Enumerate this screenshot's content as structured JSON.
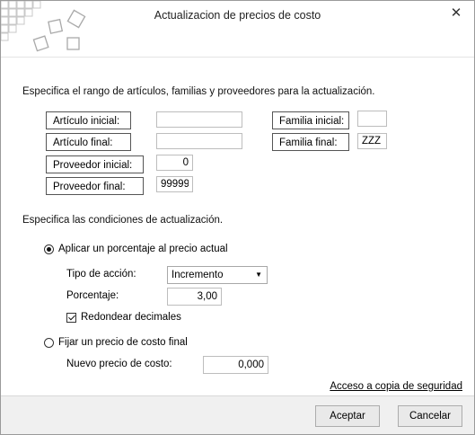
{
  "window": {
    "title": "Actualizacion de precios de costo",
    "close_glyph": "✕",
    "close_icon": "close-icon"
  },
  "range": {
    "instructions": "Especifica el rango de artículos, familias y proveedores para la actualización.",
    "articulo_inicial_label": "Artículo inicial:",
    "articulo_inicial_value": "",
    "articulo_final_label": "Artículo final:",
    "articulo_final_value": "",
    "proveedor_inicial_label": "Proveedor inicial:",
    "proveedor_inicial_value": "0",
    "proveedor_final_label": "Proveedor final:",
    "proveedor_final_value": "99999",
    "familia_inicial_label": "Familia inicial:",
    "familia_inicial_value": "",
    "familia_final_label": "Familia final:",
    "familia_final_value": "ZZZ"
  },
  "conditions": {
    "instructions": "Especifica las condiciones de actualización.",
    "option_percentage": {
      "label": "Aplicar un porcentaje al precio actual",
      "selected": true
    },
    "tipo_accion_label": "Tipo de acción:",
    "tipo_accion_value": "Incremento",
    "porcentaje_label": "Porcentaje:",
    "porcentaje_value": "3,00",
    "redondear": {
      "label": "Redondear decimales",
      "checked": true
    },
    "option_fixed": {
      "label": "Fijar un precio de costo final",
      "selected": false
    },
    "nuevo_precio_label": "Nuevo precio de costo:",
    "nuevo_precio_value": "0,000"
  },
  "backup_link": "Acceso a copia de seguridad",
  "buttons": {
    "accept": "Aceptar",
    "cancel": "Cancelar"
  }
}
